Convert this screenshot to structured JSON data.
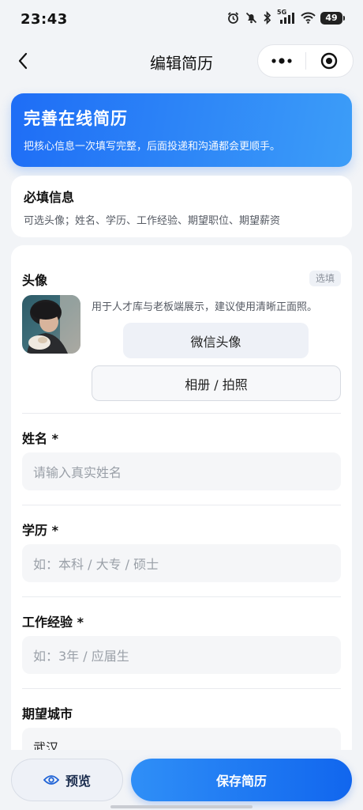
{
  "status_bar": {
    "time": "23:43",
    "signal_label": "5G",
    "battery": "49",
    "icons": [
      "alarm-icon",
      "mute-bell-icon",
      "bluetooth-icon",
      "signal-icon",
      "wifi-icon",
      "battery-icon"
    ]
  },
  "nav": {
    "title": "编辑简历",
    "back_icon": "back-arrow-icon",
    "more_icon": "more-dots-icon",
    "close_icon": "target-circle-icon"
  },
  "hero": {
    "title": "完善在线简历",
    "subtitle": "把核心信息一次填写完整，后面投递和沟通都会更顺手。"
  },
  "required_card": {
    "title": "必填信息",
    "description": "可选头像；姓名、学历、工作经验、期望职位、期望薪资"
  },
  "form": {
    "avatar": {
      "label": "头像",
      "tag": "选填",
      "hint": "用于人才库与老板端展示，建议使用清晰正面照。",
      "wechat_button": "微信头像",
      "album_button": "相册 / 拍照"
    },
    "name": {
      "label": "姓名 *",
      "placeholder": "请输入真实姓名",
      "value": ""
    },
    "education": {
      "label": "学历 *",
      "placeholder": "如：本科 / 大专 / 硕士",
      "value": ""
    },
    "experience": {
      "label": "工作经验 *",
      "placeholder": "如：3年 / 应届生",
      "value": ""
    },
    "city": {
      "label": "期望城市",
      "value": "武汉"
    }
  },
  "bottom": {
    "preview_label": "预览",
    "preview_icon": "eye-icon",
    "save_label": "保存简历"
  },
  "colors": {
    "accent": "#1e6df6",
    "accent_light": "#3c9df8",
    "background": "#f2f4f7"
  }
}
